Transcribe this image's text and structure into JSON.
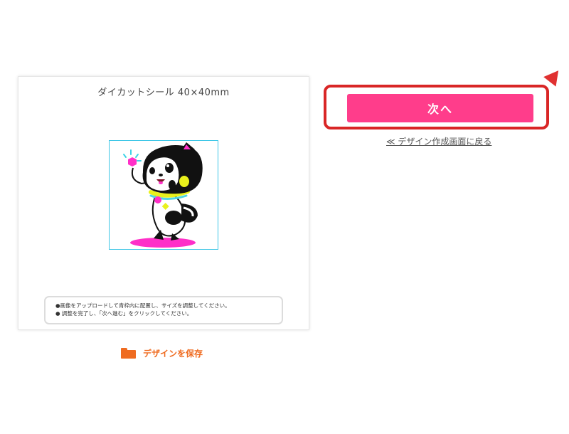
{
  "panel": {
    "title": "ダイカットシール 40×40mm",
    "notes": [
      "●画像をアップロードして青枠内に配置し、サイズを調整してください。",
      "● 調整を完了し、「次へ進む」をクリックしてください。"
    ]
  },
  "actions": {
    "next_label": "次へ",
    "back_label": "≪ デザイン作成画面に戻る",
    "save_label": "デザインを保存"
  },
  "colors": {
    "next_button": "#ff3d8b",
    "save_accent": "#ef6b20",
    "highlight_border": "#d92626",
    "canvas_border": "#3cc6e6"
  },
  "icons": {
    "save": "folder-icon",
    "pointer": "pointer-arrow-icon"
  }
}
